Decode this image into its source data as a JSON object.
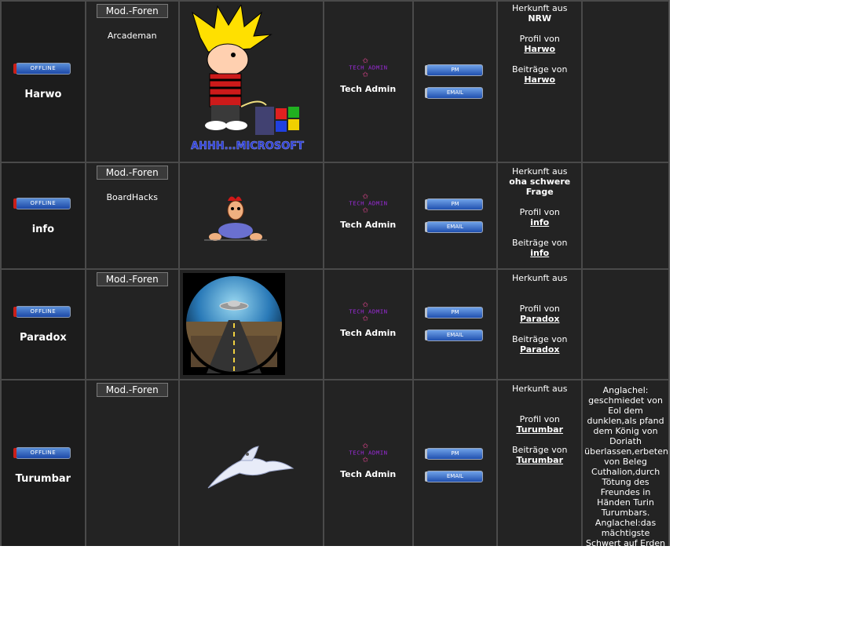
{
  "labels": {
    "offline": "OFFLINE",
    "mod_forums": "Mod.-Foren",
    "pm": "PM",
    "email": "EMAIL",
    "origin": "Herkunft aus",
    "profile": "Profil von",
    "posts": "Beiträge von",
    "rank_banner": "TECH ADMIN"
  },
  "members": [
    {
      "name": "Harwo",
      "mod_forum": "Arcademan",
      "avatar_caption": "AHHH...MICROSOFT",
      "rank": "Tech Admin",
      "origin": "NRW",
      "profile_link": "Harwo",
      "posts_link": "Harwo",
      "description": ""
    },
    {
      "name": "info",
      "mod_forum": "BoardHacks",
      "avatar_caption": "",
      "rank": "Tech Admin",
      "origin": "oha schwere Frage",
      "profile_link": "info",
      "posts_link": "info",
      "description": ""
    },
    {
      "name": "Paradox",
      "mod_forum": "",
      "avatar_caption": "",
      "rank": "Tech Admin",
      "origin": "",
      "profile_link": "Paradox",
      "posts_link": "Paradox",
      "description": ""
    },
    {
      "name": "Turumbar",
      "mod_forum": "",
      "avatar_caption": "",
      "rank": "Tech Admin",
      "origin": "",
      "profile_link": "Turumbar",
      "posts_link": "Turumbar",
      "description": "Anglachel: geschmiedet von Eol dem dunklen,als pfand dem König von Doriath überlassen,erbeten von Beleg Cuthalion,durch Tötung des Freundes in Händen Turin Turumbars. Anglachel:das mächtigste Schwert auf Erden"
    }
  ]
}
